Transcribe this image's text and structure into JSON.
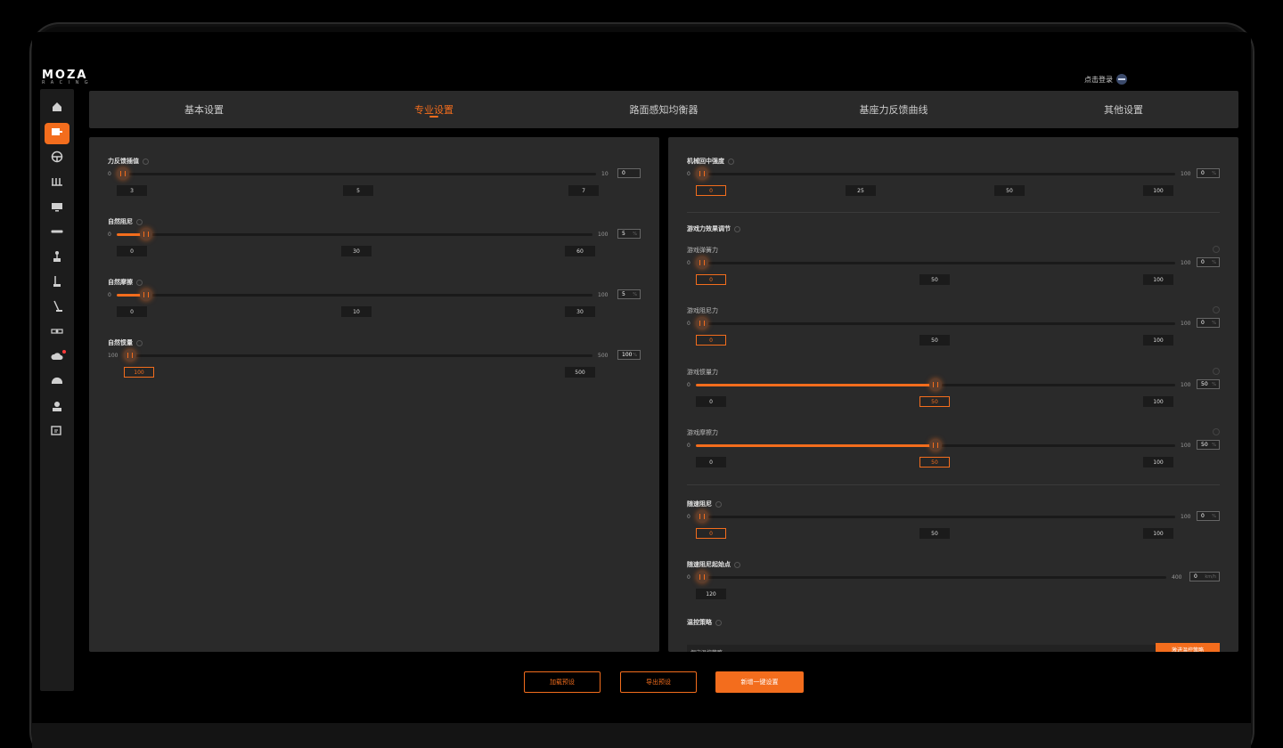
{
  "logo": {
    "main": "MOZA",
    "sub": "RACING"
  },
  "login": {
    "label": "点击登录"
  },
  "colors": {
    "accent": "#f36d1d",
    "panel": "#2a2a2a",
    "track": "#1a1a1a"
  },
  "sidebar": {
    "items": [
      {
        "icon": "home-icon"
      },
      {
        "icon": "wheelbase-icon",
        "active": true
      },
      {
        "icon": "steering-wheel-icon"
      },
      {
        "icon": "pedals-icon"
      },
      {
        "icon": "dashboard-icon"
      },
      {
        "icon": "display-strip-icon"
      },
      {
        "icon": "shifter-icon"
      },
      {
        "icon": "handbrake-icon"
      },
      {
        "icon": "stick-icon"
      },
      {
        "icon": "hub-icon"
      },
      {
        "icon": "cloud-update-icon",
        "badge": true
      },
      {
        "icon": "helmet-icon"
      },
      {
        "icon": "user-icon"
      },
      {
        "icon": "feedback-icon"
      }
    ]
  },
  "tabs": [
    {
      "label": "基本设置"
    },
    {
      "label": "专业设置",
      "active": true
    },
    {
      "label": "路面感知均衡器"
    },
    {
      "label": "基座力反馈曲线"
    },
    {
      "label": "其他设置"
    }
  ],
  "left": {
    "ffb_interp": {
      "title": "力反馈插值",
      "min": "0",
      "max": "10",
      "value": "0",
      "level": 0.0,
      "chips": [
        "3",
        "5",
        "7"
      ]
    },
    "natural_damper": {
      "title": "自然阻尼",
      "min": "0",
      "max": "100",
      "value": "5",
      "unit": "%",
      "level": 0.05,
      "chips": [
        "0",
        "30",
        "60"
      ]
    },
    "natural_friction": {
      "title": "自然摩擦",
      "min": "0",
      "max": "100",
      "value": "5",
      "unit": "%",
      "level": 0.05,
      "chips": [
        "0",
        "10",
        "30"
      ]
    },
    "natural_inertia": {
      "title": "自然惯量",
      "min": "100",
      "max": "500",
      "value": "100",
      "unit": "%",
      "level": 0.0,
      "chips": [
        "100",
        "500"
      ]
    }
  },
  "right": {
    "mech_center": {
      "title": "机械回中强度",
      "min": "0",
      "max": "100",
      "value": "0",
      "unit": "%",
      "level": 0.0,
      "chips": [
        "0",
        "25",
        "50",
        "100"
      ]
    },
    "game_fx": {
      "title": "游戏力效果调节"
    },
    "game_spring": {
      "title": "游戏弹簧力",
      "min": "0",
      "max": "100",
      "value": "0",
      "unit": "%",
      "level": 0.0,
      "chips": [
        "0",
        "50",
        "100"
      ]
    },
    "game_damper": {
      "title": "游戏阻尼力",
      "min": "0",
      "max": "100",
      "value": "0",
      "unit": "%",
      "level": 0.0,
      "chips": [
        "0",
        "50",
        "100"
      ]
    },
    "game_inertia": {
      "title": "游戏惯量力",
      "min": "0",
      "max": "100",
      "value": "50",
      "unit": "%",
      "level": 0.5,
      "chips": [
        "0",
        "50",
        "100"
      ]
    },
    "game_friction": {
      "title": "游戏摩擦力",
      "min": "0",
      "max": "100",
      "value": "50",
      "unit": "%",
      "level": 0.5,
      "chips": [
        "0",
        "50",
        "100"
      ]
    },
    "speed_damper": {
      "title": "随速阻尼",
      "min": "0",
      "max": "100",
      "value": "0",
      "unit": "%",
      "level": 0.0,
      "chips": [
        "0",
        "50",
        "100"
      ]
    },
    "speed_damper_start": {
      "title": "随速阻尼起始点",
      "min": "0",
      "max": "400",
      "value": "0",
      "unit": "km/h",
      "level": 0.0,
      "chips": [
        "120"
      ]
    },
    "temp_strategy": {
      "title": "温控策略",
      "sub_label": "保守温控策略",
      "button": "激进温控策略"
    }
  },
  "bottom": {
    "load": "加载预设",
    "export": "导出预设",
    "new": "新增一键设置"
  }
}
